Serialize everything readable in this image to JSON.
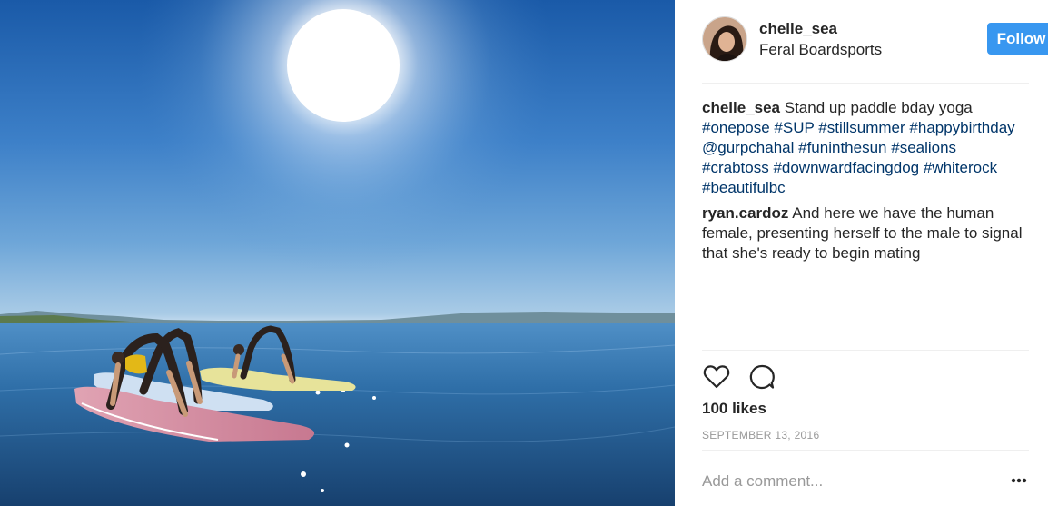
{
  "post": {
    "photo_icon": "sup-yoga-photo",
    "author": {
      "username": "chelle_sea",
      "location": "Feral Boardsports",
      "avatar_icon": "profile-avatar"
    },
    "follow_label": "Follow",
    "caption": {
      "username": "chelle_sea",
      "text": "Stand up paddle bday yoga",
      "tags": [
        "#onepose",
        "#SUP",
        "#stillsummer",
        "#happybirthday",
        "@gurpchahal",
        "#funinthesun",
        "#sealions",
        "#crabtoss",
        "#downwardfacingdog",
        "#whiterock",
        "#beautifulbc"
      ]
    },
    "comments": [
      {
        "username": "ryan.cardoz",
        "text": "And here we have the human female, presenting herself to the male to signal that she's ready to begin mating"
      }
    ],
    "actions": {
      "like_icon": "heart-icon",
      "comment_icon": "comment-bubble-icon"
    },
    "likes": "100 likes",
    "date": "SEPTEMBER 13, 2016",
    "add_comment_placeholder": "Add a comment...",
    "more_icon": "more-options-icon"
  },
  "colors": {
    "follow_button": "#3897f0",
    "hashtag": "#003569",
    "muted_text": "#999999",
    "primary_text": "#262626"
  }
}
